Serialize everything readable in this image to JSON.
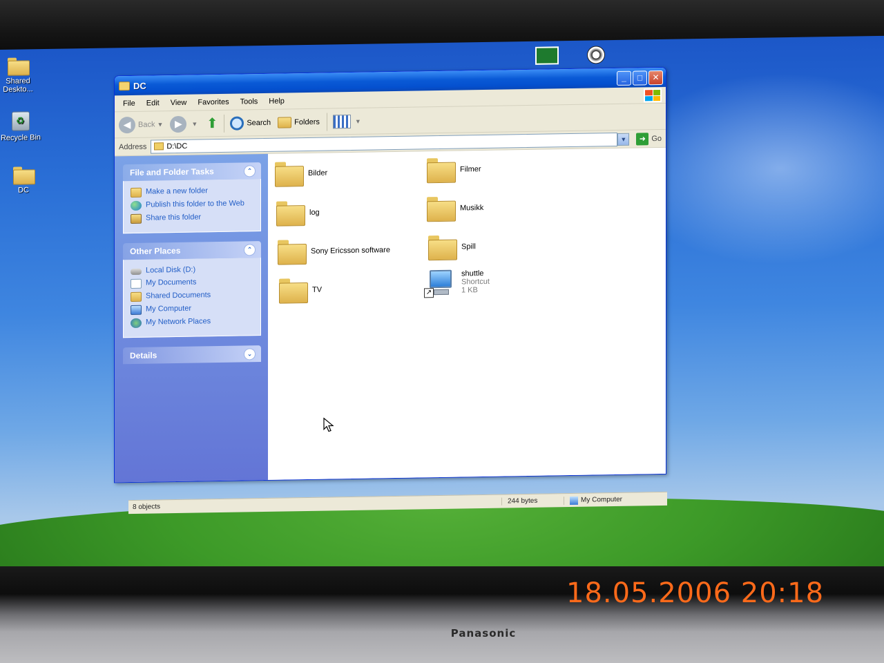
{
  "desktop": {
    "icons": [
      {
        "label": "Shared Deskto..."
      },
      {
        "label": "Recycle Bin"
      },
      {
        "label": "DC"
      }
    ]
  },
  "window": {
    "title": "DC",
    "menu": [
      "File",
      "Edit",
      "View",
      "Favorites",
      "Tools",
      "Help"
    ],
    "toolbar": {
      "back": "Back",
      "search": "Search",
      "folders": "Folders"
    },
    "address": {
      "label": "Address",
      "value": "D:\\DC",
      "go": "Go"
    },
    "tasks": {
      "title": "File and Folder Tasks",
      "items": [
        "Make a new folder",
        "Publish this folder to the Web",
        "Share this folder"
      ]
    },
    "other_places": {
      "title": "Other Places",
      "items": [
        "Local Disk (D:)",
        "My Documents",
        "Shared Documents",
        "My Computer",
        "My Network Places"
      ]
    },
    "details": {
      "title": "Details"
    },
    "files": [
      {
        "name": "Bilder"
      },
      {
        "name": "Filmer"
      },
      {
        "name": "log"
      },
      {
        "name": "Musikk"
      },
      {
        "name": "Sony Ericsson software"
      },
      {
        "name": "Spill"
      },
      {
        "name": "TV"
      },
      {
        "name": "shuttle",
        "type": "Shortcut",
        "size": "1 KB"
      }
    ],
    "status": {
      "objects": "8 objects",
      "size": "244 bytes",
      "zone": "My Computer"
    }
  },
  "photo": {
    "timestamp": "18.05.2006  20:18",
    "brand": "Panasonic"
  },
  "colors": {
    "titlebar": "#0a5ad6",
    "taskpane": "#6375d6",
    "link": "#215dc6",
    "timestamp": "#ff6a1a"
  }
}
